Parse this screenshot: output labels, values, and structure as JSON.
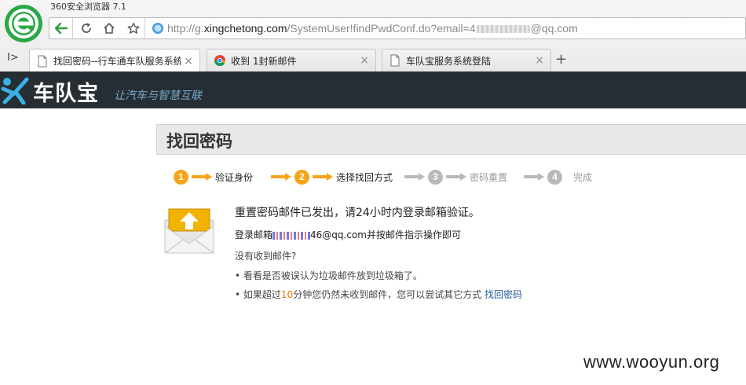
{
  "browser": {
    "title": "360安全浏览器 7.1",
    "url": {
      "prefix": "http://g.",
      "domain": "xingchetong.com",
      "path": "/SystemUser!findPwdConf.do?email=4",
      "suffix": "@qq.com"
    },
    "tabs": [
      {
        "label": "找回密码--行车通车队服务系统",
        "active": true,
        "icon": "page-icon"
      },
      {
        "label": "收到 1封新邮件",
        "active": false,
        "icon": "chrome-icon"
      },
      {
        "label": "车队宝服务系统登陆",
        "active": false,
        "icon": "page-icon"
      }
    ],
    "sidebar_toggle": "I>",
    "new_tab": "+",
    "tab_close": "×"
  },
  "site": {
    "name": "车队宝",
    "slogan": "让汽车与智慧互联",
    "header_color": "#262d33"
  },
  "page": {
    "title": "找回密码",
    "steps": [
      {
        "num": "1",
        "label": "验证身份",
        "state": "done"
      },
      {
        "num": "2",
        "label": "选择找回方式",
        "state": "done"
      },
      {
        "num": "3",
        "label": "密码重置",
        "state": "pending"
      },
      {
        "num": "4",
        "label": "完成",
        "state": "pending"
      }
    ],
    "message": {
      "title": "重置密码邮件已发出，请24小时内登录邮箱验证。",
      "email_prefix": "登录邮箱",
      "email_suffix": "46@qq.com并按邮件指示操作即可",
      "not_received": "没有收到邮件?",
      "tip1": "• 看看是否被误认为垃圾邮件放到垃圾箱了。",
      "tip2_before": "• 如果超过",
      "tip2_highlight": "10",
      "tip2_after": "分钟您仍然未收到邮件，您可以尝试其它方式 ",
      "tip2_link": "找回密码"
    }
  },
  "watermark": "www.wooyun.org",
  "colors": {
    "accent": "#f7a41a",
    "pending": "#b9b9b9",
    "link": "#1f5b95"
  }
}
